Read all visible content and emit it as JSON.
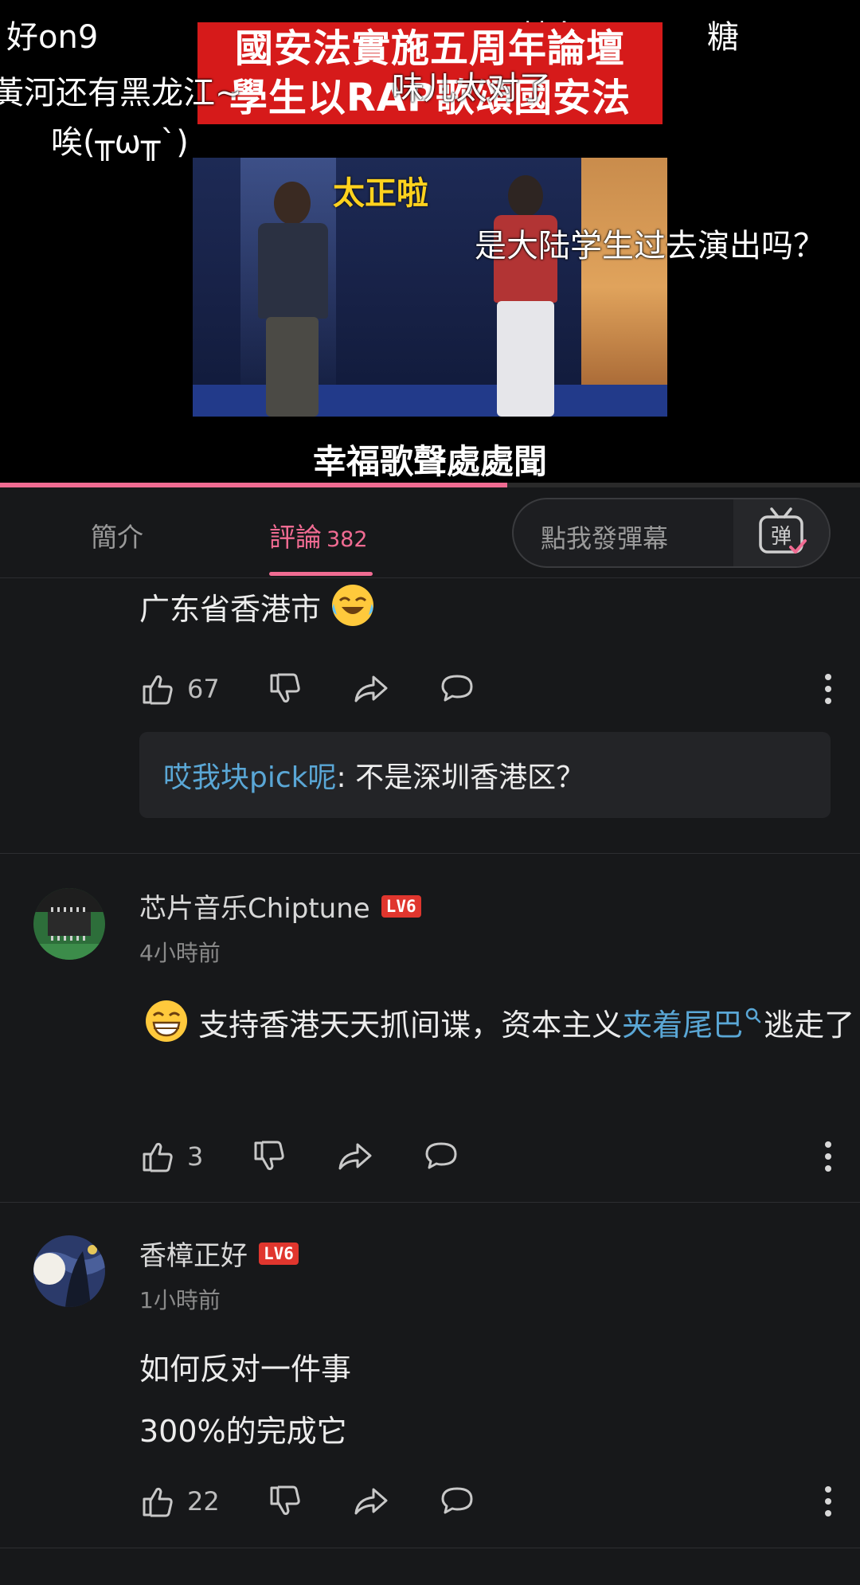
{
  "video": {
    "title": "國安法實施五周年論壇\n學生以RAP歌頌國安法",
    "subtitle": "幸福歌聲處處聞",
    "on_screen_caption": "太正啦",
    "progress": 0.59,
    "danmaku": [
      "好on9",
      "抽象",
      "糖",
      "黃河还有黑龙江~",
      "味儿太对了",
      "唉(╥ω╥`)",
      "是大陆学生过去演出吗？"
    ]
  },
  "tabs": {
    "intro_label": "簡介",
    "comments_label": "評論",
    "comments_count": "382",
    "danmaku_placeholder": "點我發彈幕",
    "danmaku_toggle_icon": "danmaku-tv-icon",
    "danmaku_toggle_glyph": "弹"
  },
  "comments": [
    {
      "text": "广东省香港市",
      "emoji": "crying-laughing",
      "likes": "67",
      "reply": {
        "author": "哎我块pick呢",
        "sep": ": ",
        "text": "不是深圳香港区？"
      }
    },
    {
      "username": "芯片音乐Chiptune",
      "level": "LV6",
      "time": "4小時前",
      "emoji": "grinning",
      "text_before": "支持香港天天抓间谍，资本主义",
      "link_text": "夹着尾巴",
      "link_icon": "search-icon",
      "text_after": "逃走了",
      "likes": "3"
    },
    {
      "username": "香樟正好",
      "level": "LV6",
      "time": "1小時前",
      "lines": [
        "如何反对一件事",
        "300%的完成它"
      ],
      "likes": "22"
    }
  ],
  "colors": {
    "accent": "#f06b92",
    "link": "#5aa7d6",
    "level_badge": "#e0362e",
    "background": "#17181a"
  }
}
